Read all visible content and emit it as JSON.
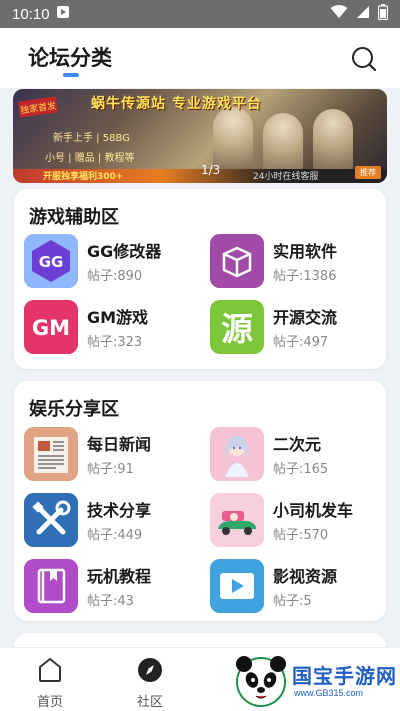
{
  "status_bar": {
    "time": "10:10"
  },
  "header": {
    "title": "论坛分类"
  },
  "banner": {
    "tag": "独家首发",
    "title": "蜗牛传源站 专业游戏平台",
    "line2": "新手上手 | 58BG",
    "line3": "小号 | 赠品 | 教程等",
    "bottom_text": "开服独享福利300+",
    "bottom_right": "24小时在线客服",
    "pager": "1/3",
    "badge": "推荐"
  },
  "sections": [
    {
      "title": "游戏辅助区",
      "items": [
        {
          "name": "GG修改器",
          "count": "帖子:890",
          "icon": "gg-modifier-icon"
        },
        {
          "name": "实用软件",
          "count": "帖子:1386",
          "icon": "box-icon"
        },
        {
          "name": "GM游戏",
          "count": "帖子:323",
          "icon": "gm-icon"
        },
        {
          "name": "开源交流",
          "count": "帖子:497",
          "icon": "source-icon",
          "icon_text": "源"
        }
      ]
    },
    {
      "title": "娱乐分享区",
      "items": [
        {
          "name": "每日新闻",
          "count": "帖子:91",
          "icon": "newspaper-icon"
        },
        {
          "name": "二次元",
          "count": "帖子:165",
          "icon": "anime-girl-icon"
        },
        {
          "name": "技术分享",
          "count": "帖子:449",
          "icon": "tools-icon"
        },
        {
          "name": "小司机发车",
          "count": "帖子:570",
          "icon": "car-icon"
        },
        {
          "name": "玩机教程",
          "count": "帖子:43",
          "icon": "book-icon"
        },
        {
          "name": "影视资源",
          "count": "帖子:5",
          "icon": "video-play-icon"
        }
      ]
    }
  ],
  "gm_icon_text": "GM",
  "bottom_nav": {
    "home": "首页",
    "community": "社区"
  },
  "watermark": {
    "text": "国宝手游网",
    "url": "www.GB315.com"
  },
  "colors": {
    "accent": "#3b8cf5",
    "background": "#eef1f6",
    "status_bar": "#6d6d6d"
  }
}
